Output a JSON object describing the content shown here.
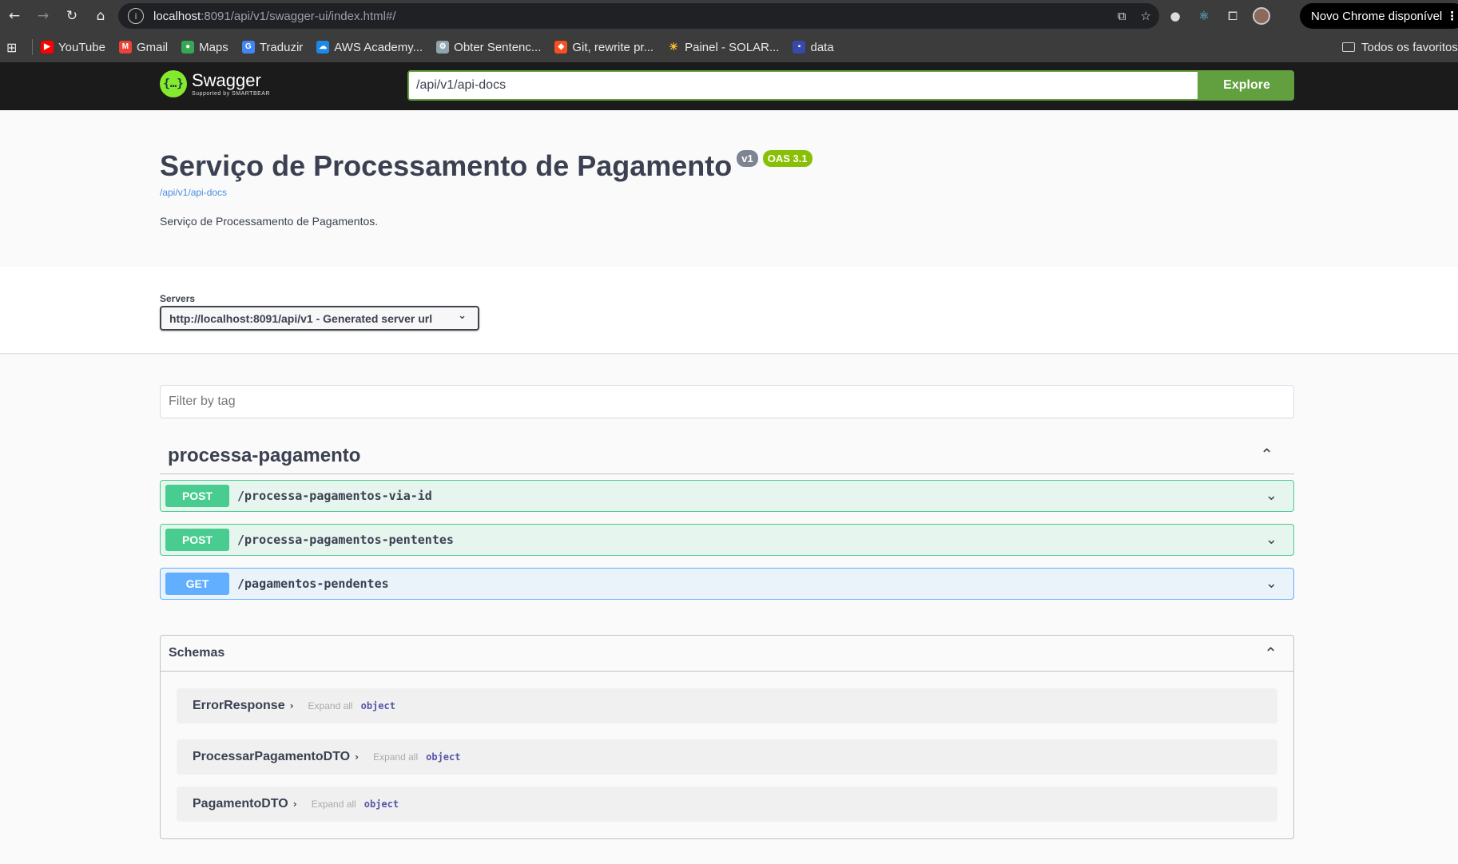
{
  "browser": {
    "url_host": "localhost",
    "url_rest": ":8091/api/v1/swagger-ui/index.html#/",
    "update_label": "Novo Chrome disponível",
    "bookmarks": [
      {
        "label": "YouTube",
        "icon": "youtube-icon",
        "color": "#ff0000"
      },
      {
        "label": "Gmail",
        "icon": "gmail-icon",
        "color": "#ea4335"
      },
      {
        "label": "Maps",
        "icon": "maps-icon",
        "color": "#34a853"
      },
      {
        "label": "Traduzir",
        "icon": "translate-icon",
        "color": "#4285f4"
      },
      {
        "label": "AWS Academy...",
        "icon": "cloud-icon",
        "color": "#1e88e5"
      },
      {
        "label": "Obter Sentenc...",
        "icon": "settings-icon",
        "color": "#90a4ae"
      },
      {
        "label": "Git, rewrite pr...",
        "icon": "git-icon",
        "color": "#f4511e"
      },
      {
        "label": "Painel - SOLAR...",
        "icon": "sun-icon",
        "color": "#fbc02d"
      },
      {
        "label": "data",
        "icon": "data-icon",
        "color": "#3949ab"
      }
    ],
    "all_bookmarks_label": "Todos os favoritos"
  },
  "topbar": {
    "logo_title": "Swagger",
    "logo_sub": "Supported by SMARTBEAR",
    "spec_url": "/api/v1/api-docs",
    "explore_label": "Explore"
  },
  "info": {
    "title": "Serviço de Processamento de Pagamento",
    "version": "v1",
    "oas": "OAS 3.1",
    "spec_link": "/api/v1/api-docs",
    "description": "Serviço de Processamento de Pagamentos."
  },
  "servers": {
    "label": "Servers",
    "selected": "http://localhost:8091/api/v1 - Generated server url"
  },
  "filter": {
    "placeholder": "Filter by tag"
  },
  "tag": {
    "name": "processa-pagamento",
    "operations": [
      {
        "method": "POST",
        "path": "/processa-pagamentos-via-id"
      },
      {
        "method": "POST",
        "path": "/processa-pagamentos-pententes"
      },
      {
        "method": "GET",
        "path": "/pagamentos-pendentes"
      }
    ]
  },
  "schemas": {
    "title": "Schemas",
    "expand_label": "Expand all",
    "items": [
      {
        "name": "ErrorResponse",
        "type": "object"
      },
      {
        "name": "ProcessarPagamentoDTO",
        "type": "object"
      },
      {
        "name": "PagamentoDTO",
        "type": "object"
      }
    ]
  }
}
